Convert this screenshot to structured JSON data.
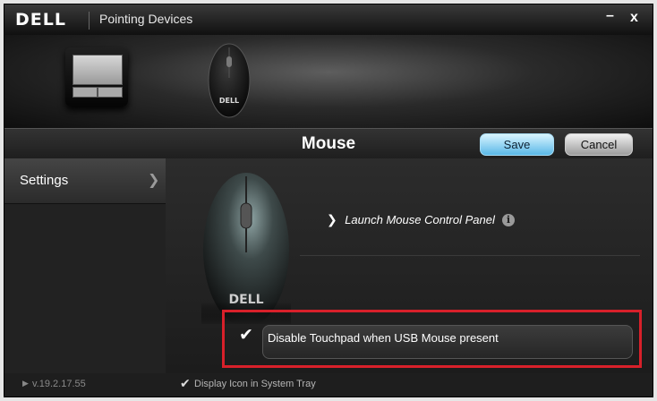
{
  "window": {
    "logo": "DELL",
    "title": "Pointing Devices",
    "minimize_icon": "–",
    "close_icon": "x"
  },
  "devices": {
    "items": [
      {
        "name": "touchpad",
        "icon": "touchpad-icon"
      },
      {
        "name": "mouse",
        "icon": "mouse-icon",
        "selected": true
      }
    ],
    "mouse_logo": "DELL"
  },
  "header": {
    "title": "Mouse",
    "save_label": "Save",
    "cancel_label": "Cancel"
  },
  "sidebar": {
    "items": [
      {
        "label": "Settings",
        "icon": "chevron-right-icon",
        "selected": true
      }
    ],
    "version": "v.19.2.17.55"
  },
  "main": {
    "launch_label": "Launch Mouse Control Panel",
    "launch_icon": "chevron-right-icon",
    "info_icon": "i",
    "mouse_logo": "DELL",
    "option": {
      "label": "Disable Touchpad when USB Mouse present",
      "checked": true
    }
  },
  "footer": {
    "tray_label": "Display Icon in System Tray",
    "tray_checked": true
  },
  "colors": {
    "accent": "#5ab8e8",
    "highlight": "#d8202a",
    "background": "#1b1b1b"
  }
}
